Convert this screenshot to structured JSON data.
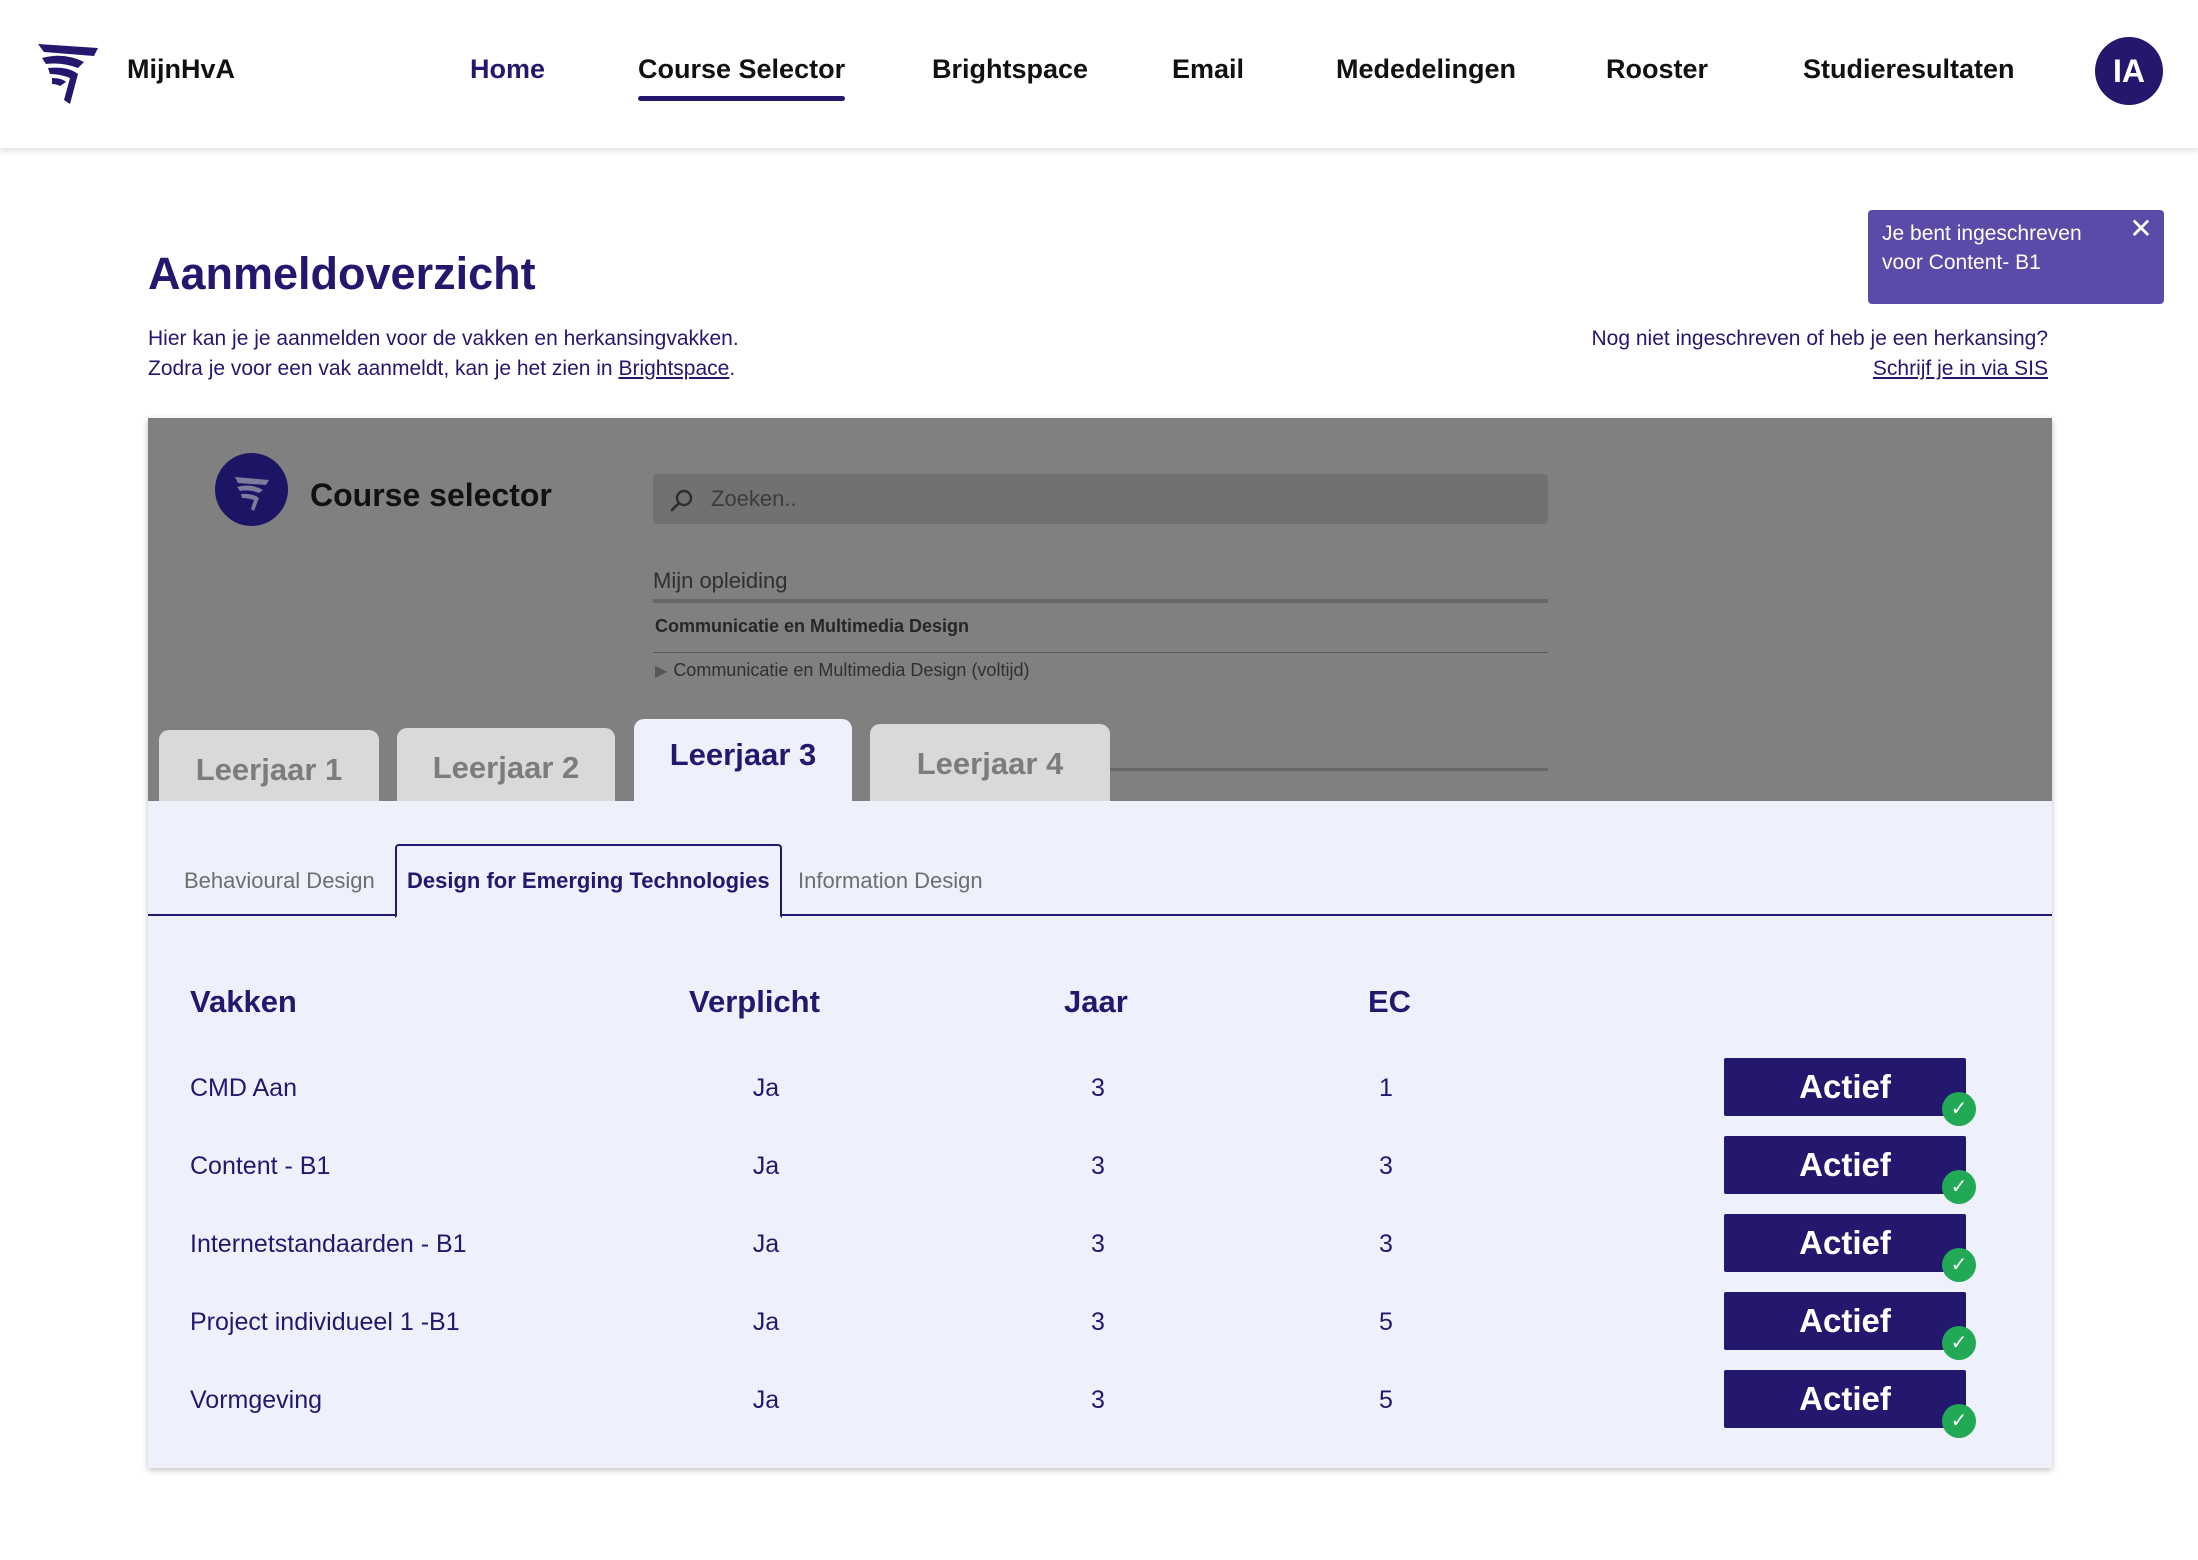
{
  "header": {
    "brand": "MijnHvA",
    "nav": [
      {
        "label": "Home"
      },
      {
        "label": "Course Selector"
      },
      {
        "label": "Brightspace"
      },
      {
        "label": "Email"
      },
      {
        "label": "Mededelingen"
      },
      {
        "label": "Rooster"
      },
      {
        "label": "Studieresultaten"
      }
    ],
    "avatar_initials": "IA"
  },
  "page": {
    "title": "Aanmeldoverzicht",
    "intro_line1": "Hier kan je je aanmelden voor de vakken en herkansingvakken.",
    "intro_line2_prefix": "Zodra je voor een vak aanmeldt, kan je het zien in ",
    "intro_line2_link": "Brightspace",
    "intro_line2_suffix": ".",
    "right_line1": "Nog niet ingeschreven of heb je een herkansing?",
    "right_link": "Schrijf je in via SIS"
  },
  "toast": {
    "message": "Je bent ingeschreven voor Content- B1",
    "close_glyph": "✕"
  },
  "course_selector": {
    "title": "Course selector",
    "search_placeholder": "Zoeken..",
    "opleiding_label": "Mijn opleiding",
    "opleiding_name": "Communicatie en Multimedia Design",
    "opleiding_variant": "Communicatie en Multimedia Design (voltijd)"
  },
  "year_tabs": [
    {
      "label": "Leerjaar 1"
    },
    {
      "label": "Leerjaar 2"
    },
    {
      "label": "Leerjaar 3",
      "active": true
    },
    {
      "label": "Leerjaar 4"
    }
  ],
  "track_tabs": [
    {
      "label": "Behavioural Design"
    },
    {
      "label": "Design for Emerging Technologies",
      "active": true
    },
    {
      "label": "Information Design"
    }
  ],
  "table": {
    "headers": {
      "vakken": "Vakken",
      "verplicht": "Verplicht",
      "jaar": "Jaar",
      "ec": "EC"
    },
    "rows": [
      {
        "vak": "CMD Aan",
        "verplicht": "Ja",
        "jaar": "3",
        "ec": "1",
        "status": "Actief"
      },
      {
        "vak": "Content - B1",
        "verplicht": "Ja",
        "jaar": "3",
        "ec": "3",
        "status": "Actief"
      },
      {
        "vak": "Internetstandaarden - B1",
        "verplicht": "Ja",
        "jaar": "3",
        "ec": "3",
        "status": "Actief"
      },
      {
        "vak": "Project individueel 1 -B1",
        "verplicht": "Ja",
        "jaar": "3",
        "ec": "5",
        "status": "Actief"
      },
      {
        "vak": "Vormgeving",
        "verplicht": "Ja",
        "jaar": "3",
        "ec": "5",
        "status": "Actief"
      }
    ],
    "check_glyph": "✓"
  },
  "icons": {
    "logo": "hva-logo-icon",
    "search": "search-icon",
    "close": "close-icon",
    "check": "check-icon",
    "expand": "triangle-right-icon"
  },
  "colors": {
    "primary": "#23186e",
    "toast": "#5b4aa8",
    "success": "#21a956",
    "card_bg": "#eef1fc",
    "overlay": "#808080"
  }
}
